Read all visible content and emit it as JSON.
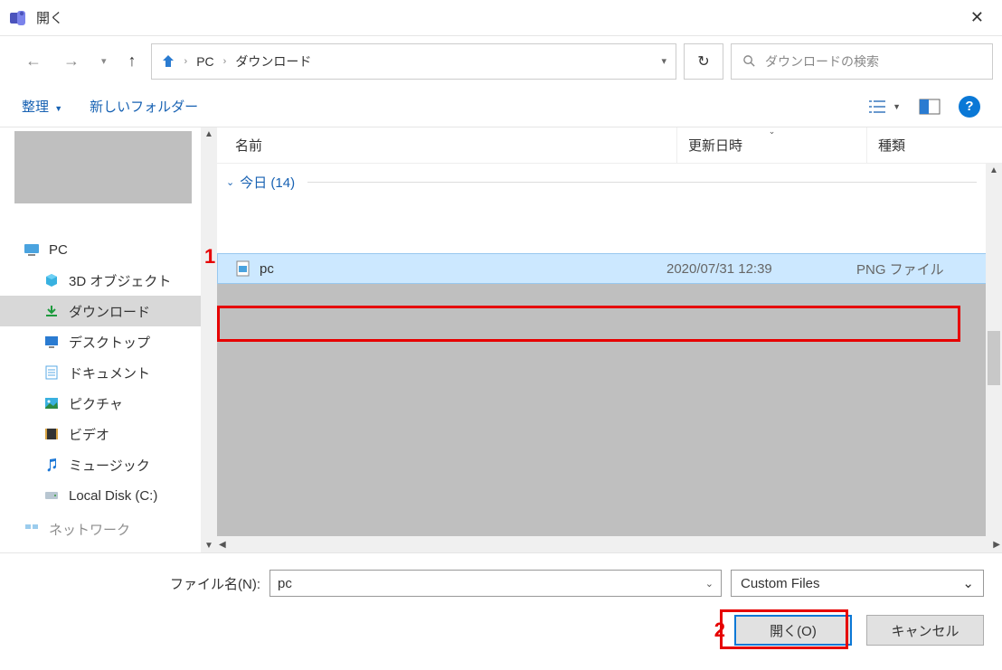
{
  "window": {
    "title": "開く"
  },
  "nav": {
    "crumbs": [
      "PC",
      "ダウンロード"
    ]
  },
  "search": {
    "placeholder": "ダウンロードの検索"
  },
  "toolbar": {
    "organize": "整理",
    "new_folder": "新しいフォルダー"
  },
  "sidebar": {
    "pc": "PC",
    "items": [
      {
        "label": "3D オブジェクト"
      },
      {
        "label": "ダウンロード"
      },
      {
        "label": "デスクトップ"
      },
      {
        "label": "ドキュメント"
      },
      {
        "label": "ピクチャ"
      },
      {
        "label": "ビデオ"
      },
      {
        "label": "ミュージック"
      },
      {
        "label": "Local Disk (C:)"
      }
    ],
    "network": "ネットワーク"
  },
  "columns": {
    "name": "名前",
    "date": "更新日時",
    "type": "種類"
  },
  "group": {
    "label": "今日 (14)"
  },
  "files": [
    {
      "name": "pc",
      "date": "2020/07/31 12:39",
      "type": "PNG ファイル"
    }
  ],
  "footer": {
    "filename_label": "ファイル名(N):",
    "filename_value": "pc",
    "filetype": "Custom Files",
    "open": "開く(O)",
    "cancel": "キャンセル"
  },
  "annotations": {
    "one": "1",
    "two": "2"
  }
}
